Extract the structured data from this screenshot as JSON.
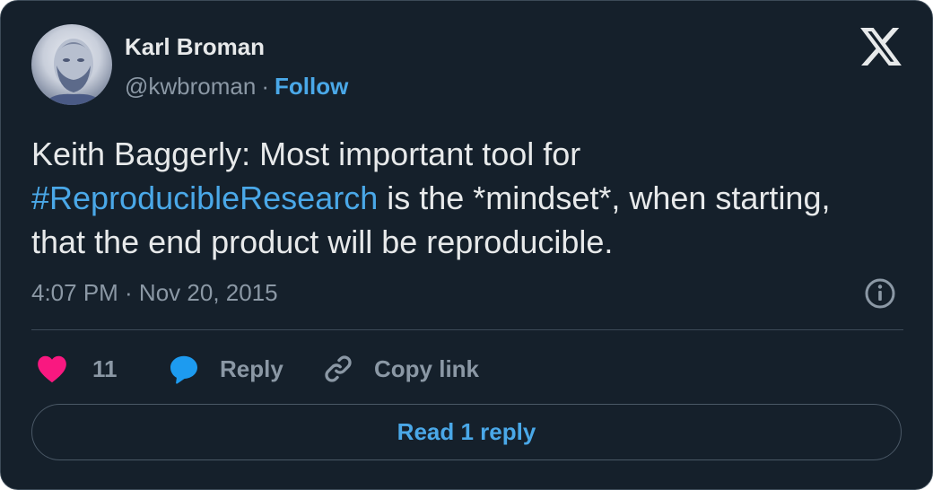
{
  "author": {
    "name": "Karl Broman",
    "handle": "@kwbroman",
    "separator": "·",
    "follow_label": "Follow"
  },
  "tweet": {
    "text_before": "Keith Baggerly: Most important tool for ",
    "hashtag": "#ReproducibleResearch",
    "text_after": " is the *mindset*, when starting, that the end product will be reproducible.",
    "timestamp": "4:07 PM · Nov 20, 2015"
  },
  "actions": {
    "like_count": "11",
    "reply_label": "Reply",
    "copy_link_label": "Copy link"
  },
  "read_replies_label": "Read 1 reply",
  "icons": {
    "logo": "x-logo-icon",
    "info": "info-icon",
    "like": "heart-icon",
    "reply": "speech-bubble-icon",
    "copy": "link-icon"
  },
  "colors": {
    "background": "#15202b",
    "accent": "#4aa8e8",
    "like": "#f91880",
    "muted": "#8b98a5",
    "text": "#e7e9ea"
  }
}
